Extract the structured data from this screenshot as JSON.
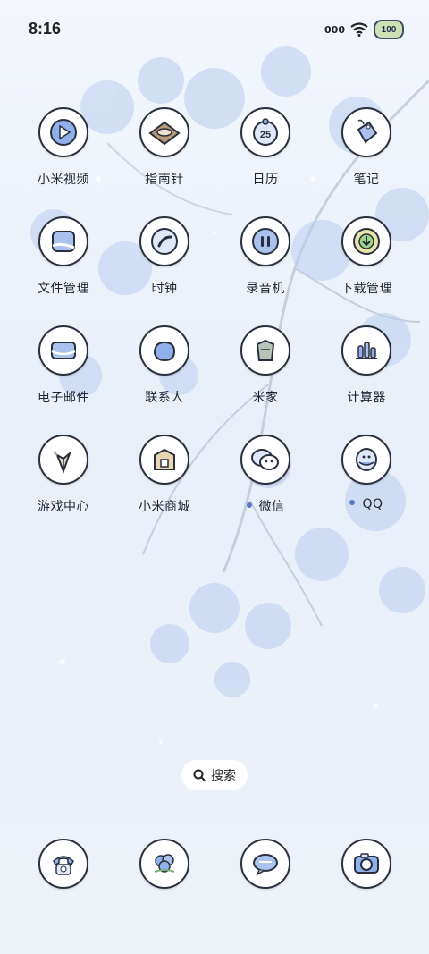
{
  "status": {
    "time": "8:16",
    "signal": "000",
    "battery": "100"
  },
  "apps": [
    {
      "label": "小米视频",
      "icon": "play-video-icon"
    },
    {
      "label": "指南针",
      "icon": "compass-icon"
    },
    {
      "label": "日历",
      "icon": "calendar-icon",
      "date": "25"
    },
    {
      "label": "笔记",
      "icon": "notes-tag-icon"
    },
    {
      "label": "文件管理",
      "icon": "folder-icon"
    },
    {
      "label": "时钟",
      "icon": "clock-icon"
    },
    {
      "label": "录音机",
      "icon": "recorder-icon"
    },
    {
      "label": "下载管理",
      "icon": "download-icon"
    },
    {
      "label": "电子邮件",
      "icon": "mail-icon"
    },
    {
      "label": "联系人",
      "icon": "contacts-icon"
    },
    {
      "label": "米家",
      "icon": "mijia-icon"
    },
    {
      "label": "计算器",
      "icon": "calculator-icon"
    },
    {
      "label": "游戏中心",
      "icon": "game-center-icon"
    },
    {
      "label": "小米商城",
      "icon": "store-icon"
    },
    {
      "label": "微信",
      "icon": "wechat-icon",
      "new": true
    },
    {
      "label": "QQ",
      "icon": "qq-icon",
      "new": true
    }
  ],
  "search": {
    "label": "搜索"
  },
  "dock": [
    {
      "icon": "phone-icon"
    },
    {
      "icon": "gallery-flower-icon"
    },
    {
      "icon": "messages-icon"
    },
    {
      "icon": "camera-icon"
    }
  ],
  "colors": {
    "accent": "#5a78c8",
    "blossom": "#a9c3ee",
    "icon_outline": "#2a2f3d"
  }
}
